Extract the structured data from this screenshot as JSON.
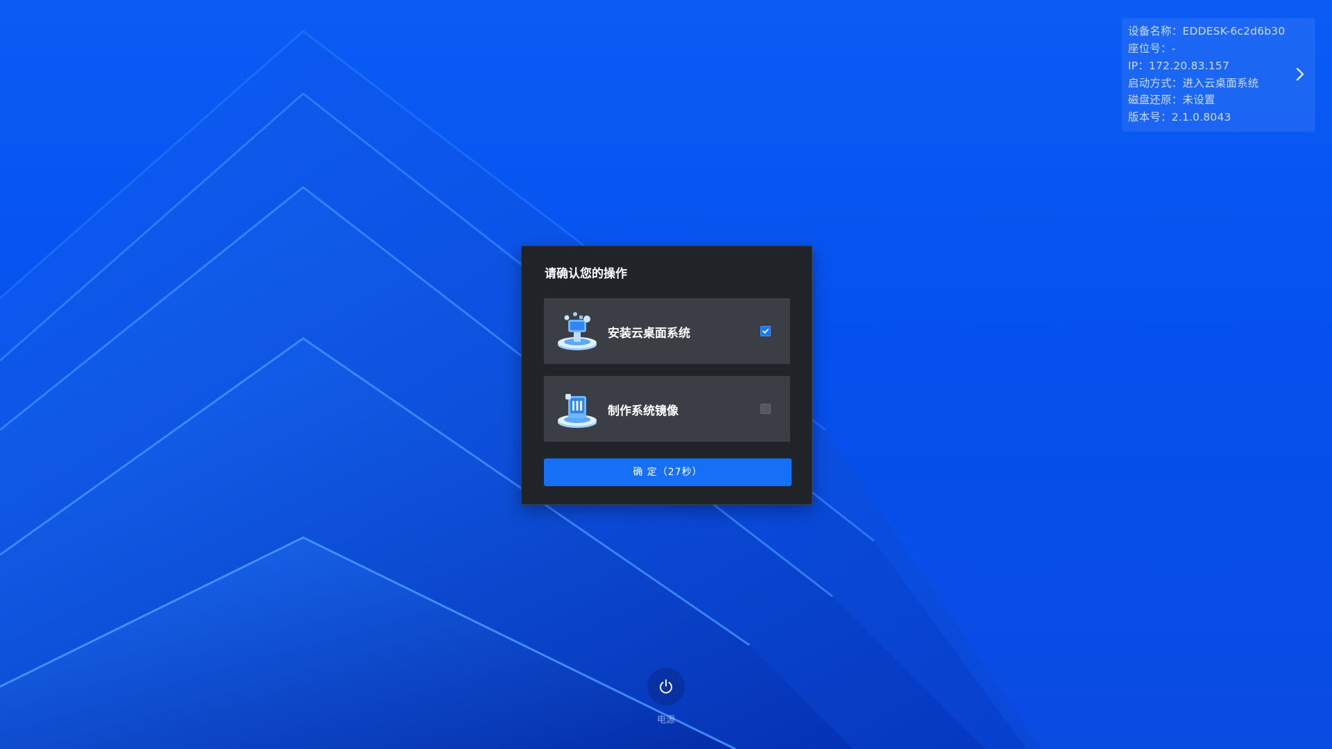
{
  "device_info": {
    "device_name": "设备名称：EDDESK-6c2d6b30",
    "seat_number": "座位号：-",
    "ip": "IP：172.20.83.157",
    "boot_mode": "启动方式：进入云桌面系统",
    "disk_restore": "磁盘还原：未设置",
    "version": "版本号：2.1.0.8043",
    "expand_icon": "chevron-right-icon"
  },
  "dialog": {
    "title": "请确认您的操作",
    "options": [
      {
        "label": "安装云桌面系统",
        "icon": "install-desktop-icon",
        "checked": true
      },
      {
        "label": "制作系统镜像",
        "icon": "system-image-icon",
        "checked": false
      }
    ],
    "confirm_label": "确 定（27秒）"
  },
  "power": {
    "icon": "power-icon",
    "label": "电源"
  },
  "colors": {
    "background": "#0651ee",
    "dialog": "#202328",
    "option": "#3b3e45",
    "accent": "#1670f7"
  }
}
